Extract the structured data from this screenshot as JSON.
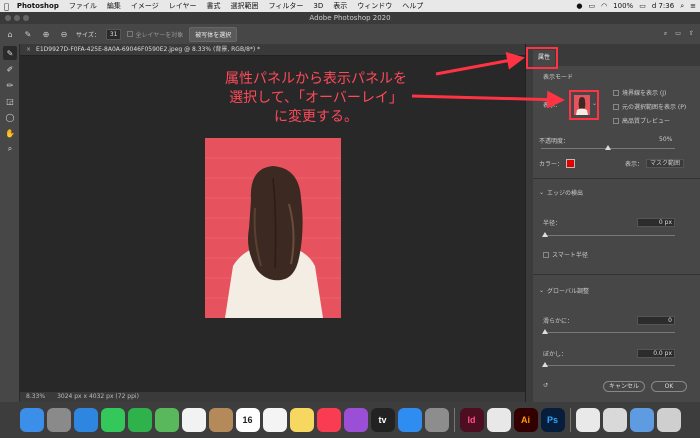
{
  "menubar": {
    "apple": "",
    "app_name": "Photoshop",
    "items": [
      "ファイル",
      "編集",
      "イメージ",
      "レイヤー",
      "書式",
      "選択範囲",
      "フィルター",
      "3D",
      "表示",
      "ウィンドウ",
      "ヘルプ"
    ],
    "battery": "100%",
    "time": "d 7:36"
  },
  "window": {
    "title": "Adobe Photoshop 2020"
  },
  "options_bar": {
    "size_label": "サイズ：",
    "size_value": "31",
    "all_layers_label": "全レイヤーを対象",
    "select_subject_button": "被写体を選択"
  },
  "document": {
    "tab_label": "E1D9927D-F0FA-425E-8A0A-69046F0590E2.jpeg @ 8.33% (背景, RGB/8*) *"
  },
  "annotation": {
    "line1": "属性パネルから表示パネルを",
    "line2": "選択して、「オーバーレイ」",
    "line3": "に変更する。"
  },
  "status_bar": {
    "zoom": "8.33%",
    "doc_info": "3024 px x 4032 px (72 ppi)"
  },
  "properties_panel": {
    "tab_label": "属性",
    "view_mode_title": "表示モード",
    "view_label": "表示：",
    "show_edges": "境界線を表示 (J)",
    "show_original": "元の選択範囲を表示 (P)",
    "high_quality_preview": "高品質プレビュー",
    "opacity_label": "不透明度：",
    "opacity_value": "50%",
    "opacity_level": 0.5,
    "color_label": "カラー：",
    "color_value": "#e00000",
    "display_label": "表示：",
    "display_value": "マスク範囲",
    "edge_detection_title": "エッジの検出",
    "radius_label": "半径：",
    "radius_value": "0 px",
    "smart_radius": "スマート半径",
    "global_refinements_title": "グローバル調整",
    "smooth_label": "滑らかに：",
    "smooth_value": "0",
    "feather_label": "ぼかし：",
    "feather_value": "0.0 px",
    "cancel_button": "キャンセル",
    "ok_button": "OK"
  },
  "dock": {
    "items": [
      {
        "name": "finder",
        "color": "#3b8fe8",
        "label": ""
      },
      {
        "name": "launchpad",
        "color": "#8a8a8a",
        "label": ""
      },
      {
        "name": "safari",
        "color": "#2f86e0",
        "label": ""
      },
      {
        "name": "messages",
        "color": "#34c759",
        "label": ""
      },
      {
        "name": "facetime",
        "color": "#2fb24c",
        "label": ""
      },
      {
        "name": "maps",
        "color": "#59b85c",
        "label": ""
      },
      {
        "name": "photos",
        "color": "#f2f2f2",
        "label": ""
      },
      {
        "name": "contacts",
        "color": "#b58a5a",
        "label": ""
      },
      {
        "name": "calendar",
        "color": "#ffffff",
        "label": "16"
      },
      {
        "name": "reminders",
        "color": "#f4f4f4",
        "label": ""
      },
      {
        "name": "notes",
        "color": "#f6d860",
        "label": ""
      },
      {
        "name": "music",
        "color": "#fa3c52",
        "label": ""
      },
      {
        "name": "podcasts",
        "color": "#9b4fd6",
        "label": ""
      },
      {
        "name": "tv",
        "color": "#222222",
        "label": "tv"
      },
      {
        "name": "app-store",
        "color": "#2f8cf0",
        "label": ""
      },
      {
        "name": "system-preferences",
        "color": "#8d8d8d",
        "label": ""
      },
      {
        "name": "indesign",
        "color": "#4d0e22",
        "label": "Id"
      },
      {
        "name": "chrome",
        "color": "#e8e8e8",
        "label": ""
      },
      {
        "name": "illustrator",
        "color": "#330000",
        "label": "Ai"
      },
      {
        "name": "photoshop",
        "color": "#061e3c",
        "label": "Ps"
      },
      {
        "name": "preview",
        "color": "#e9e9e9",
        "label": ""
      },
      {
        "name": "keyboard-viewer",
        "color": "#d9d9d9",
        "label": ""
      },
      {
        "name": "downloads",
        "color": "#5f9be0",
        "label": ""
      },
      {
        "name": "trash",
        "color": "#cfcfcf",
        "label": ""
      }
    ]
  },
  "accent_color": "#ff3344"
}
